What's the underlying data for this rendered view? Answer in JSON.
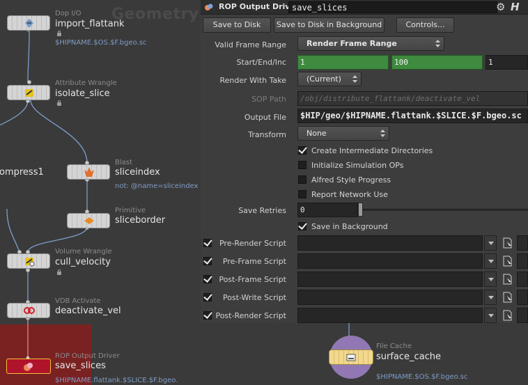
{
  "network": {
    "context_title": "Geometry",
    "nodes": [
      {
        "type": "Dop I/O",
        "name": "import_flattank",
        "sub": "$HIPNAME.$OS.$F.bgeo.sc"
      },
      {
        "type": "Attribute Wrangle",
        "name": "isolate_slice",
        "sub": ""
      },
      {
        "type": "",
        "name": "ompress1",
        "sub": ""
      },
      {
        "type": "Blast",
        "name": "sliceindex",
        "sub": "not: @name=sliceindex"
      },
      {
        "type": "Primitive",
        "name": "sliceborder",
        "sub": ""
      },
      {
        "type": "Volume Wrangle",
        "name": "cull_velocity",
        "sub": ""
      },
      {
        "type": "VDB Activate",
        "name": "deactivate_vel",
        "sub": ""
      },
      {
        "type": "ROP Output Driver",
        "name": "save_slices",
        "sub": "$HIPNAME.flattank.$SLICE.$F.bgeo."
      },
      {
        "type": "File Cache",
        "name": "surface_cache",
        "sub": "$HIPNAME.$OS.$F.bgeo.sc"
      }
    ]
  },
  "params": {
    "node_type": "ROP Output Driver",
    "node_name": "save_slices",
    "gear_icon": "gear-icon",
    "help_icon": "houdini-help-icon",
    "buttons": [
      "Save to Disk",
      "Save to Disk in Background",
      "Controls..."
    ],
    "rows": {
      "valid_frame_range": {
        "label": "Valid Frame Range",
        "value": "Render Frame Range"
      },
      "start_end_inc": {
        "label": "Start/End/Inc",
        "start": "1",
        "end": "100",
        "inc": "1"
      },
      "render_with_take": {
        "label": "Render With Take",
        "value": "(Current)"
      },
      "sop_path": {
        "label": "SOP Path",
        "value": "/obj/distribute_flattank/deactivate_vel"
      },
      "output_file": {
        "label": "Output File",
        "value": "$HIP/geo/$HIPNAME.flattank.$SLICE.$F.bgeo.sc"
      },
      "transform": {
        "label": "Transform",
        "value": "None"
      },
      "save_retries": {
        "label": "Save Retries",
        "value": "0"
      }
    },
    "checkboxes": [
      {
        "label": "Create Intermediate Directories",
        "checked": true
      },
      {
        "label": "Initialize Simulation OPs",
        "checked": false
      },
      {
        "label": "Alfred Style Progress",
        "checked": false
      },
      {
        "label": "Report Network Use",
        "checked": false
      },
      {
        "label": "Save in Background",
        "checked": true
      }
    ],
    "scripts": [
      {
        "label": "Pre-Render Script",
        "enabled": true
      },
      {
        "label": "Pre-Frame Script",
        "enabled": true
      },
      {
        "label": "Post-Frame Script",
        "enabled": true
      },
      {
        "label": "Post-Write Script",
        "enabled": true
      },
      {
        "label": "Post-Render Script",
        "enabled": true
      }
    ]
  }
}
